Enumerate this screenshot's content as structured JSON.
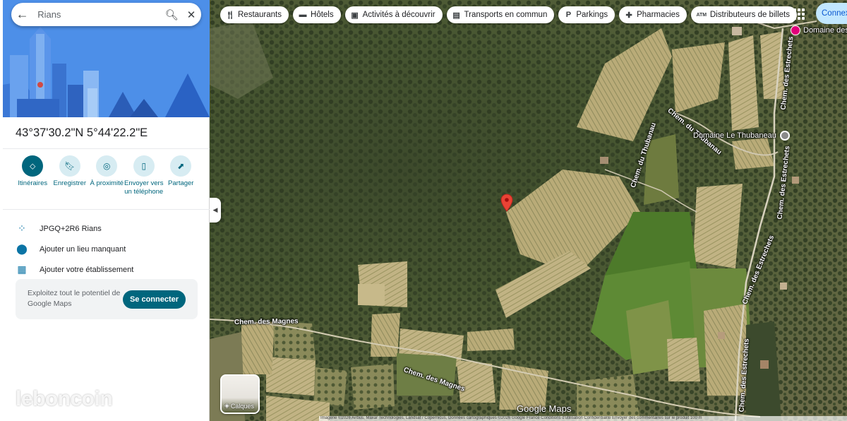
{
  "search": {
    "value": "Rians",
    "back_icon": "arrow-left-icon",
    "search_icon": "search-icon",
    "close_icon": "close-icon"
  },
  "place": {
    "coordinates": "43°37'30.2\"N 5°44'22.2\"E"
  },
  "actions": [
    {
      "label": "Itinéraires",
      "icon": "directions-icon"
    },
    {
      "label": "Enregistrer",
      "icon": "bookmark-icon"
    },
    {
      "label": "À proximité",
      "icon": "nearby-icon"
    },
    {
      "label": "Envoyer vers un téléphone",
      "icon": "send-to-phone-icon"
    },
    {
      "label": "Partager",
      "icon": "share-icon"
    }
  ],
  "info": [
    {
      "label": "JPGQ+2R6 Rians",
      "icon": "plus-code-icon"
    },
    {
      "label": "Ajouter un lieu manquant",
      "icon": "add-location-icon"
    },
    {
      "label": "Ajouter votre établissement",
      "icon": "add-business-icon"
    }
  ],
  "promo": {
    "text": "Exploitez tout le potentiel de Google Maps",
    "button": "Se connecter"
  },
  "chips": [
    {
      "label": "Restaurants",
      "icon": "fork-knife-icon"
    },
    {
      "label": "Hôtels",
      "icon": "bed-icon"
    },
    {
      "label": "Activités à découvrir",
      "icon": "camera-icon"
    },
    {
      "label": "Transports en commun",
      "icon": "bus-icon"
    },
    {
      "label": "Parkings",
      "icon": "parking-icon"
    },
    {
      "label": "Pharmacies",
      "icon": "pharmacy-icon"
    },
    {
      "label": "Distributeurs de billets",
      "icon": "atm-icon"
    }
  ],
  "header": {
    "connect_label": "Connexion"
  },
  "map": {
    "roads": [
      "Chem. du Thubanau",
      "Chem. des Estrechets",
      "Chem. des Estrechets",
      "Chem. des Estrechets",
      "Chem. des Magnes",
      "Chem. des Magnes"
    ],
    "places": [
      "Domaine des Estrechets",
      "Domaine Le Thubaneau"
    ],
    "layers_label": "Calques",
    "logo": "Google Maps",
    "attribution": "Imagerie ©2026 Airbus, Maxar Technologies, Landsat / Copernicus, Données cartographiques ©2026 Google   France   Conditions d'utilisation   Confidentialité   Envoyer des commentaires sur le produit   100 m"
  },
  "watermark": "leboncoin",
  "colors": {
    "accent": "#00667d",
    "pin": "#ea4335",
    "hero": "#4a86e8"
  }
}
